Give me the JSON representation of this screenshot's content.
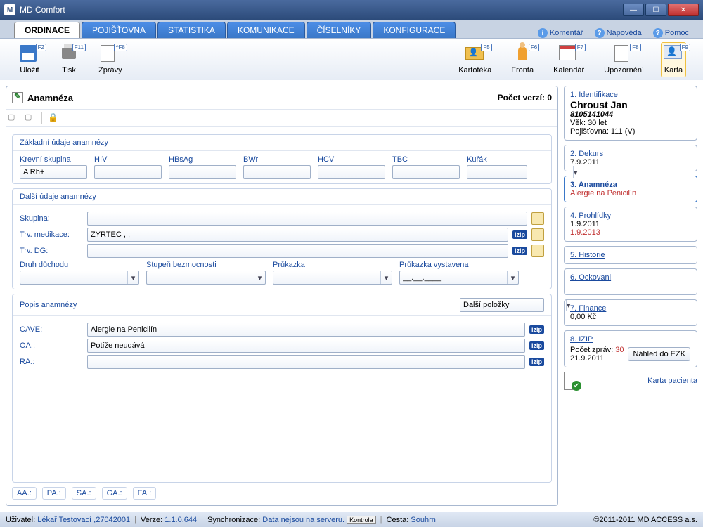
{
  "titlebar": {
    "app": "MD Comfort"
  },
  "menu": {
    "tabs": [
      "ORDINACE",
      "POJIŠŤOVNA",
      "STATISTIKA",
      "KOMUNIKACE",
      "ČÍSELNÍKY",
      "KONFIGURACE"
    ],
    "links": {
      "comment": "Komentář",
      "help": "Nápověda",
      "support": "Pomoc"
    }
  },
  "toolbar": {
    "save": {
      "label": "Uložit",
      "key": "F2"
    },
    "print": {
      "label": "Tisk",
      "key": "F11"
    },
    "reports": {
      "label": "Zprávy",
      "key": "^F8"
    },
    "cardfile": {
      "label": "Kartotéka",
      "key": "F5"
    },
    "queue": {
      "label": "Fronta",
      "key": "F6"
    },
    "calendar": {
      "label": "Kalendář",
      "key": "F7"
    },
    "alert": {
      "label": "Upozornění",
      "key": "F8"
    },
    "card": {
      "label": "Karta",
      "key": "F9"
    }
  },
  "anamneza": {
    "title": "Anamnéza",
    "versionLabel": "Počet verzí:",
    "versionCount": "0",
    "basic": {
      "title": "Základní údaje anamnézy",
      "fields": {
        "bloodgroup": {
          "label": "Krevní skupina",
          "value": "A Rh+"
        },
        "hiv": {
          "label": "HIV",
          "value": ""
        },
        "hbsag": {
          "label": "HBsAg",
          "value": ""
        },
        "bwr": {
          "label": "BWr",
          "value": ""
        },
        "hcv": {
          "label": "HCV",
          "value": ""
        },
        "tbc": {
          "label": "TBC",
          "value": ""
        },
        "smoker": {
          "label": "Kuřák",
          "value": ""
        }
      }
    },
    "other": {
      "title": "Další údaje anamnézy",
      "group": {
        "label": "Skupina:",
        "value": ""
      },
      "medication": {
        "label": "Trv. medikace:",
        "value": "ZYRTEC , ;"
      },
      "dg": {
        "label": "Trv. DG:",
        "value": ""
      },
      "pension": {
        "label": "Druh důchodu",
        "value": ""
      },
      "disability": {
        "label": "Stupeň bezmocnosti",
        "value": ""
      },
      "cardType": {
        "label": "Průkazka",
        "value": ""
      },
      "cardIssued": {
        "label": "Průkazka vystavena",
        "value": "__.__.____"
      }
    },
    "desc": {
      "title": "Popis anamnézy",
      "moreBtn": "Další položky",
      "cave": {
        "label": "CAVE:",
        "value": "Alergie na Penicilín"
      },
      "oa": {
        "label": "OA.:",
        "value": "Potíže neudává"
      },
      "ra": {
        "label": "RA.:",
        "value": ""
      }
    },
    "bottomLinks": [
      "AA.:",
      "PA.:",
      "SA.:",
      "GA.:",
      "FA.:"
    ]
  },
  "patient": {
    "id": {
      "link": "1. Identifikace",
      "name": "Chroust Jan",
      "num": "8105141044",
      "age": "Věk: 30 let",
      "ins": "Pojišťovna: 111 (V)"
    },
    "dekurs": {
      "link": "2. Dekurs",
      "date": "7.9.2011"
    },
    "anam": {
      "link": "3. Anamnéza",
      "allergy": "Alergie na Penicilín"
    },
    "exams": {
      "link": "4. Prohlídky",
      "d1": "1.9.2011",
      "d2": "1.9.2013"
    },
    "history": {
      "link": "5. Historie"
    },
    "vacc": {
      "link": "6. Ockovani"
    },
    "finance": {
      "link": "7. Finance",
      "amount": "0,00 Kč"
    },
    "izip": {
      "link": "8. IZIP",
      "msgLabel": "Počet zpráv:",
      "msgCount": "30",
      "date": "21.9.2011",
      "btn": "Náhled do EZK"
    },
    "cardLink": "Karta pacienta"
  },
  "status": {
    "userLabel": "Uživatel:",
    "user": "Lékař Testovací ,27042001",
    "verLabel": "Verze:",
    "ver": "1.1.0.644",
    "syncLabel": "Synchronizace:",
    "sync": "Data nejsou na serveru.",
    "syncBtn": "Kontrola",
    "pathLabel": "Cesta:",
    "path": "Souhrn",
    "copy": "©2011-2011 MD ACCESS a.s."
  }
}
